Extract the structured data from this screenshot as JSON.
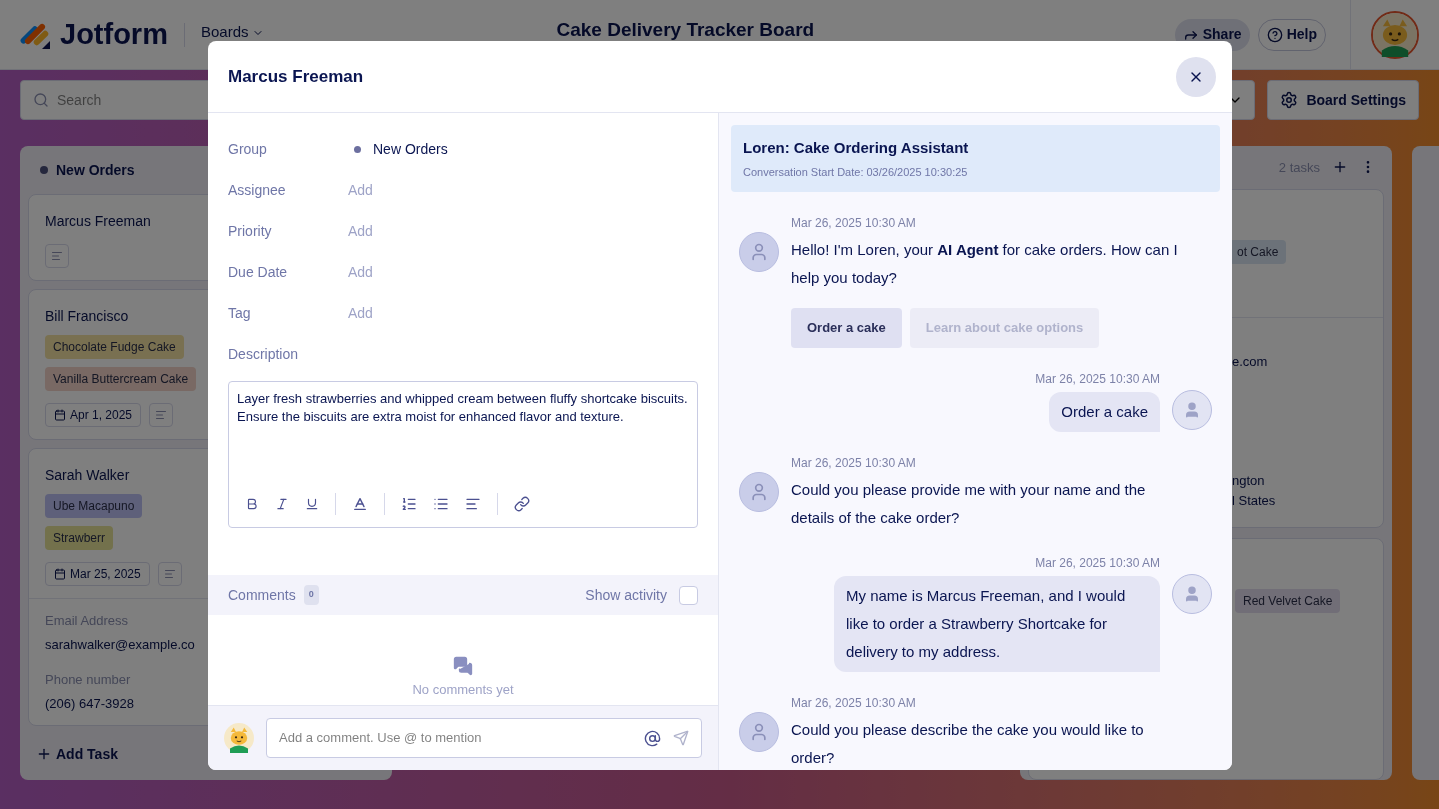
{
  "header": {
    "logo": "Jotform",
    "menu": "Boards",
    "title": "Cake Delivery Tracker Board",
    "share": "Share",
    "help": "Help"
  },
  "toolbar": {
    "search_placeholder": "Search",
    "settings": "Board Settings"
  },
  "columns": [
    {
      "title": "New Orders",
      "add_task": "Add Task",
      "cards": [
        {
          "name": "Marcus Freeman"
        },
        {
          "name": "Bill Francisco",
          "tags": [
            "Chocolate Fudge Cake",
            "Vanilla Buttercream Cake"
          ],
          "date": "Apr 1, 2025"
        },
        {
          "name": "Sarah Walker",
          "tags": [
            "Ube Macapuno",
            "Strawberr"
          ],
          "date": "Mar 25, 2025",
          "fields": [
            {
              "label": "Email Address",
              "value": "sarahwalker@example.co"
            },
            {
              "label": "Phone number",
              "value": "(206) 647-3928"
            }
          ]
        }
      ]
    },
    {
      "count": "2 tasks",
      "cards": [
        {
          "tags": [
            "ot Cake"
          ],
          "fields": [
            "e.com",
            "ngton",
            "l States"
          ]
        },
        {
          "tags": [
            "Red Velvet Cake"
          ]
        }
      ]
    }
  ],
  "modal": {
    "title": "Marcus Freeman",
    "fields": [
      {
        "label": "Group",
        "value": "New Orders",
        "kind": "group",
        "color": "#6c6f9f"
      },
      {
        "label": "Assignee",
        "value": "Add",
        "kind": "empty"
      },
      {
        "label": "Priority",
        "value": "Add",
        "kind": "empty"
      },
      {
        "label": "Due Date",
        "value": "Add",
        "kind": "empty"
      },
      {
        "label": "Tag",
        "value": "Add",
        "kind": "empty"
      }
    ],
    "description_label": "Description",
    "description": "Layer fresh strawberries and whipped cream between fluffy shortcake biscuits. Ensure the biscuits are extra moist for enhanced flavor and texture.",
    "comments": {
      "label": "Comments",
      "count": "0",
      "show_activity": "Show activity",
      "checked": false,
      "empty": "No comments yet",
      "placeholder": "Add a comment. Use @ to mention"
    },
    "chat": {
      "title": "Loren: Cake Ordering Assistant",
      "subtitle": "Conversation Start Date: 03/26/2025 10:30:25",
      "messages": [
        {
          "kind": "agent",
          "time": "Mar 26, 2025 10:30 AM",
          "text": "Hello! I'm Loren, your **AI Agent** for cake orders. How can I help you today?",
          "options": [
            {
              "label": "Order a cake",
              "selected": true
            },
            {
              "label": "Learn about cake options",
              "selected": false
            }
          ]
        },
        {
          "kind": "user",
          "time": "Mar 26, 2025 10:30 AM",
          "text": "Order a cake"
        },
        {
          "kind": "agent",
          "time": "Mar 26, 2025 10:30 AM",
          "text": "Could you please provide me with your name and the details of the cake order?"
        },
        {
          "kind": "user",
          "time": "Mar 26, 2025 10:30 AM",
          "text": "My name is Marcus Freeman, and I would like to order a Strawberry Shortcake for delivery to my address."
        },
        {
          "kind": "agent",
          "time": "Mar 26, 2025 10:30 AM",
          "text": "Could you please describe the cake you would like to order?"
        }
      ]
    }
  }
}
